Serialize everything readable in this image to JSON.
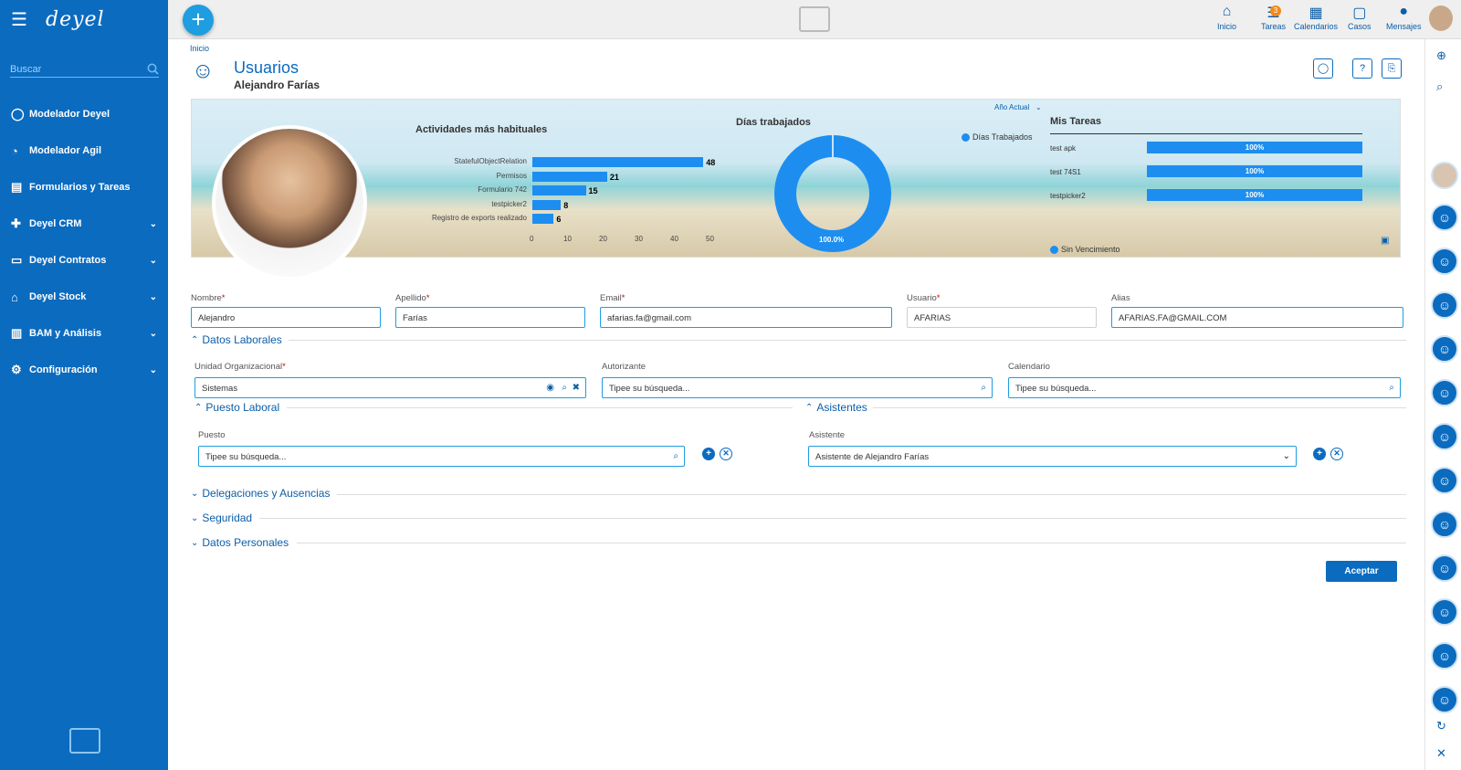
{
  "sidebar": {
    "logo": "deyel",
    "search_placeholder": "Buscar",
    "items": [
      {
        "label": "Modelador Deyel",
        "icon": "circle-icon",
        "chevron": false
      },
      {
        "label": "Modelador Agil",
        "icon": "gauge-icon",
        "chevron": false
      },
      {
        "label": "Formularios y Tareas",
        "icon": "form-icon",
        "chevron": false
      },
      {
        "label": "Deyel CRM",
        "icon": "puzzle-icon",
        "chevron": true
      },
      {
        "label": "Deyel Contratos",
        "icon": "document-icon",
        "chevron": true
      },
      {
        "label": "Deyel Stock",
        "icon": "bank-icon",
        "chevron": true
      },
      {
        "label": "BAM y Análisis",
        "icon": "chart-icon",
        "chevron": true
      },
      {
        "label": "Configuración",
        "icon": "gear-icon",
        "chevron": true
      }
    ]
  },
  "topnav": {
    "items": [
      {
        "label": "Inicio",
        "icon": "home-icon"
      },
      {
        "label": "Tareas",
        "icon": "tasks-icon",
        "badge": "3"
      },
      {
        "label": "Calendarios",
        "icon": "calendar-icon"
      },
      {
        "label": "Casos",
        "icon": "case-icon"
      },
      {
        "label": "Mensajes",
        "icon": "message-icon"
      }
    ]
  },
  "page": {
    "breadcrumb": "Inicio",
    "title": "Usuarios",
    "subtitle": "Alejandro Farías"
  },
  "dashboard": {
    "year_selector": "Año Actual",
    "activities": {
      "title": "Actividades más habituales",
      "ticks": [
        "0",
        "10",
        "20",
        "30",
        "40",
        "50"
      ]
    },
    "days": {
      "title": "Días trabajados",
      "legend": "Días Trabajados",
      "percent": "100.0%"
    },
    "tasks": {
      "title": "Mis Tareas",
      "items": [
        {
          "label": "test apk",
          "value": "100%"
        },
        {
          "label": "test 74S1",
          "value": "100%"
        },
        {
          "label": "testpicker2",
          "value": "100%"
        }
      ],
      "legend": "Sin Vencimiento"
    }
  },
  "chart_data": [
    {
      "type": "bar",
      "title": "Actividades más habituales",
      "categories": [
        "StatefulObjectRelation",
        "Permisos",
        "Formulario 742",
        "testpicker2",
        "Registro de exports realizado"
      ],
      "values": [
        48,
        21,
        15,
        8,
        6
      ],
      "xlim": [
        0,
        50
      ]
    },
    {
      "type": "pie",
      "title": "Días trabajados",
      "categories": [
        "Días Trabajados"
      ],
      "values": [
        100.0
      ]
    },
    {
      "type": "bar",
      "title": "Mis Tareas",
      "categories": [
        "test apk",
        "test 74S1",
        "testpicker2"
      ],
      "values": [
        100,
        100,
        100
      ],
      "series_name": "Sin Vencimiento"
    }
  ],
  "form": {
    "nombre": {
      "label": "Nombre",
      "value": "Alejandro"
    },
    "apellido": {
      "label": "Apellido",
      "value": "Farías"
    },
    "email": {
      "label": "Email",
      "value": "afarias.fa@gmail.com"
    },
    "usuario": {
      "label": "Usuario",
      "value": "AFARIAS"
    },
    "alias": {
      "label": "Alias",
      "value": "AFARIAS.FA@GMAIL.COM"
    },
    "datos_laborales": "Datos Laborales",
    "unidad": {
      "label": "Unidad Organizacional",
      "value": "Sistemas"
    },
    "autorizante": {
      "label": "Autorizante",
      "placeholder": "Tipee su búsqueda..."
    },
    "calendario": {
      "label": "Calendario",
      "placeholder": "Tipee su búsqueda..."
    },
    "puesto_laboral": "Puesto Laboral",
    "asistentes": "Asistentes",
    "puesto": {
      "label": "Puesto",
      "placeholder": "Tipee su búsqueda..."
    },
    "asistente": {
      "label": "Asistente",
      "value": "Asistente de Alejandro Farías"
    },
    "delegaciones": "Delegaciones y Ausencias",
    "seguridad": "Seguridad",
    "datos_personales": "Datos Personales",
    "accept": "Aceptar"
  }
}
